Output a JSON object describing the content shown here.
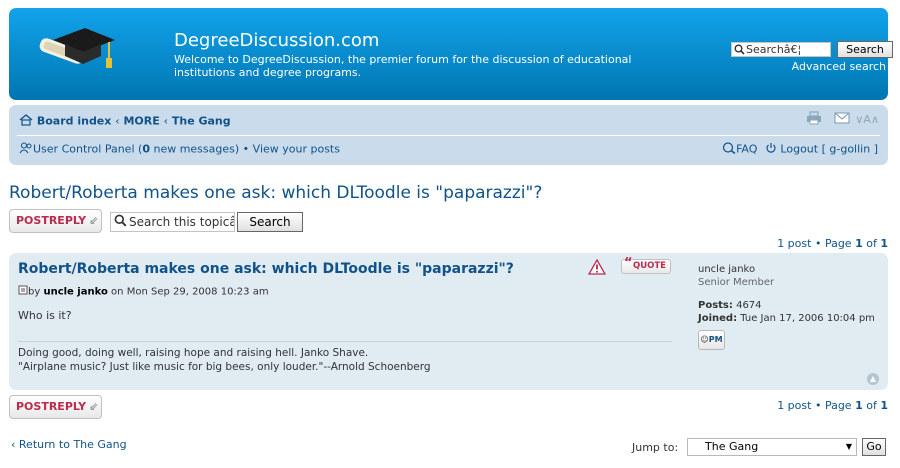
{
  "header": {
    "site_title": "DegreeDiscussion.com",
    "site_description": "Welcome to DegreeDiscussion, the premier forum for the discussion of educational institutions and degree programs.",
    "search_value": "Searchâ€¦",
    "search_button": "Search",
    "advanced_search": "Advanced search"
  },
  "navbar": {
    "breadcrumb": [
      "Board index",
      "MORE",
      "The Gang"
    ],
    "breadcrumb_sep": "‹",
    "ucp_label": "User Control Panel",
    "new_messages_count": "0",
    "new_messages_text": "new messages",
    "view_posts": "View your posts",
    "faq": "FAQ",
    "logout": "Logout",
    "username": "g-gollin",
    "font_size_control": "A"
  },
  "topic": {
    "title": "Robert/Roberta makes one ask: which DLToodle is \"paparazzi\"?",
    "post_reply_label": "POSTREPLY",
    "search_placeholder": "Search this topicâ",
    "search_button": "Search",
    "pagination": {
      "count_text": "1 post",
      "page_label": "Page",
      "current": "1",
      "of": "of",
      "total": "1"
    }
  },
  "post": {
    "title": "Robert/Roberta makes one ask: which DLToodle is \"paparazzi\"?",
    "by": "by",
    "author": "uncle janko",
    "on": "on",
    "date": "Mon Sep 29, 2008 10:23 am",
    "content": "Who is it?",
    "signature_line1": "Doing good, doing well, raising hope and raising hell. Janko Shave.",
    "signature_line2": "\"Airplane music? Just like music for big bees, only louder.\"--Arnold Schoenberg",
    "quote_label": "QUOTE",
    "profile": {
      "username": "uncle janko",
      "rank": "Senior Member",
      "posts_label": "Posts:",
      "posts_count": "4674",
      "joined_label": "Joined:",
      "joined_date": "Tue Jan 17, 2006 10:04 pm"
    },
    "pm_label": "PM"
  },
  "footer": {
    "return_link": "Return to The Gang",
    "jump_label": "Jump to:",
    "jump_selected": "The Gang",
    "go_button": "Go"
  },
  "colors": {
    "header_top": "#12a3eb",
    "header_bottom": "#0076b1",
    "navbar_bg": "#cadceb",
    "post_bg": "#e1ebf2",
    "link": "#105289",
    "button_red": "#bc2a4d"
  }
}
